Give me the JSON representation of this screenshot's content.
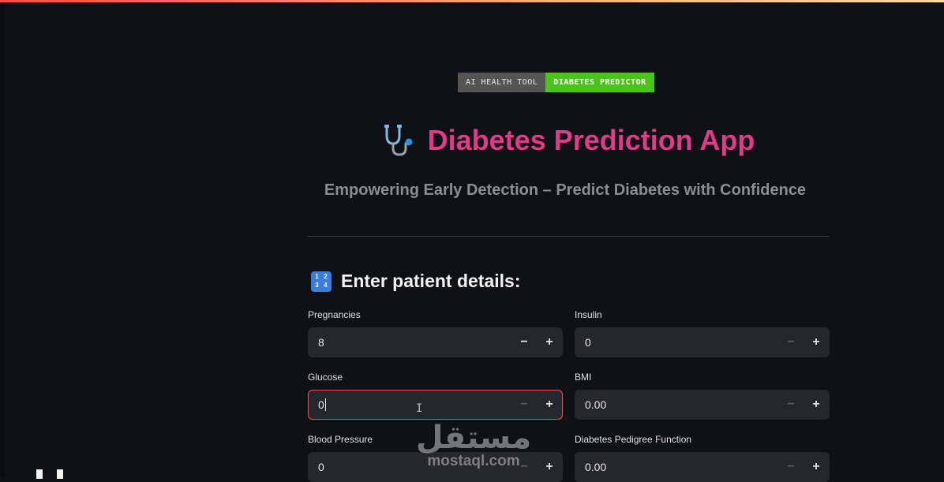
{
  "badge": {
    "left_label": "AI HEALTH TOOL",
    "right_label": "DIABETES PREDICTOR"
  },
  "header": {
    "title": "Diabetes Prediction App",
    "icon": "stethoscope-icon",
    "subtitle": "Empowering Early Detection – Predict Diabetes with Confidence"
  },
  "section": {
    "icon": "input-numbers-icon",
    "heading": "Enter patient details:"
  },
  "fields": {
    "pregnancies": {
      "label": "Pregnancies",
      "value": "8"
    },
    "glucose": {
      "label": "Glucose",
      "value": "0"
    },
    "blood_pressure": {
      "label": "Blood Pressure",
      "value": "0"
    },
    "insulin": {
      "label": "Insulin",
      "value": "0"
    },
    "bmi": {
      "label": "BMI",
      "value": "0.00"
    },
    "dpf": {
      "label": "Diabetes Pedigree Function",
      "value": "0.00"
    }
  },
  "stepper": {
    "minus": "−",
    "plus": "+"
  },
  "watermark": {
    "arabic": "مستقل",
    "latin": "mostaql.com"
  },
  "colors": {
    "accent": "#e13a88",
    "badge_green": "#4ac41b",
    "focus_border": "#ff4b4b",
    "background": "#0f1116",
    "input_bg": "#26272e"
  }
}
